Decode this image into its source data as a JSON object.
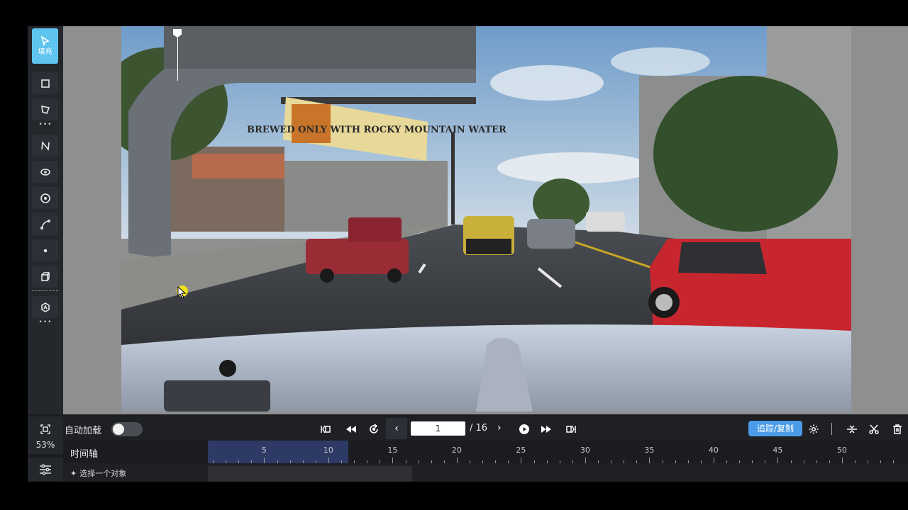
{
  "toolbar": {
    "active_tool_label": "填充",
    "tools": [
      "pointer-fill-icon",
      "rectangle-icon",
      "polygon-icon",
      "polyline-node-icon",
      "ellipse-icon",
      "circle-point-icon",
      "curve-icon",
      "point-icon",
      "cuboid-icon",
      "ai-assist-icon"
    ]
  },
  "canvas": {
    "billboard_text": "BREWED ONLY WITH ROCKY MOUNTAIN WATER"
  },
  "zoom": {
    "percent": "53%"
  },
  "controls": {
    "autoload_label": "自动加载",
    "autoload_on": false,
    "current_frame": "1",
    "total_frames": "/ 16",
    "track_copy_label": "追踪/复制"
  },
  "timeline": {
    "label": "时间轴",
    "ticks": [
      "5",
      "10",
      "15",
      "20",
      "25",
      "30",
      "35",
      "40",
      "45",
      "50"
    ]
  },
  "object_row": {
    "label": "选择一个对象"
  },
  "colors": {
    "accent": "#4a9ce8",
    "active_tool": "#5fc4ef",
    "range_highlight": "#2e3a66"
  }
}
